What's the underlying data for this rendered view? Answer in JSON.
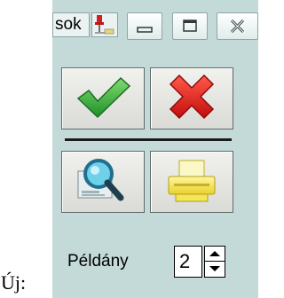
{
  "page": {
    "label": "Új:"
  },
  "window": {
    "title": "sok",
    "icons": {
      "app": "printer-app-icon",
      "minimize": "minimize-icon",
      "maximize": "maximize-icon",
      "close": "close-icon"
    }
  },
  "toolbar": {
    "buttons": [
      {
        "name": "ok",
        "icon": "green-check-icon",
        "color": "#2fa82f"
      },
      {
        "name": "cancel",
        "icon": "red-x-icon",
        "color": "#e02020"
      },
      {
        "name": "preview",
        "icon": "magnifier-preview-icon",
        "color": "#2a8fb0"
      },
      {
        "name": "print",
        "icon": "yellow-printer-icon",
        "color": "#f2e23a"
      }
    ]
  },
  "copies": {
    "label": "Példány",
    "value": "2"
  },
  "colors": {
    "window_background": "#c4dad8"
  }
}
